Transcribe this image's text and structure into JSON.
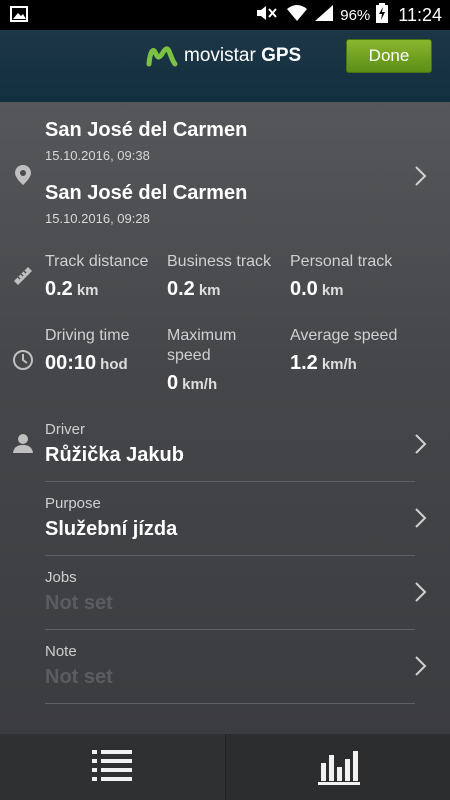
{
  "status_bar": {
    "battery_percent": "96%",
    "time": "11:24",
    "icons": [
      "image-icon",
      "mute-icon",
      "wifi-icon",
      "signal-icon",
      "battery-charging-icon"
    ]
  },
  "header": {
    "brand_name": "movistar",
    "brand_suffix": "GPS",
    "done_label": "Done",
    "brand_color": "#7cc242",
    "done_color": "#6c9d1e"
  },
  "trip": {
    "start_place": "San José del Carmen",
    "start_time": "15.10.2016, 09:38",
    "end_place": "San José del Carmen",
    "end_time": "15.10.2016, 09:28"
  },
  "stats_distance": {
    "track_distance_label": "Track distance",
    "track_distance_value": "0.2",
    "track_distance_unit": "km",
    "business_track_label": "Business track",
    "business_track_value": "0.2",
    "business_track_unit": "km",
    "personal_track_label": "Personal track",
    "personal_track_value": "0.0",
    "personal_track_unit": "km"
  },
  "stats_time": {
    "driving_time_label": "Driving time",
    "driving_time_value": "00:10",
    "driving_time_unit": "hod",
    "max_speed_label": "Maximum speed",
    "max_speed_value": "0",
    "max_speed_unit": "km/h",
    "avg_speed_label": "Average speed",
    "avg_speed_value": "1.2",
    "avg_speed_unit": "km/h"
  },
  "fields": {
    "driver_label": "Driver",
    "driver_value": "Růžička Jakub",
    "purpose_label": "Purpose",
    "purpose_value": "Služební jízda",
    "jobs_label": "Jobs",
    "jobs_value": "Not set",
    "note_label": "Note",
    "note_value": "Not set"
  },
  "tabs": [
    "list-icon",
    "bar-chart-icon"
  ]
}
